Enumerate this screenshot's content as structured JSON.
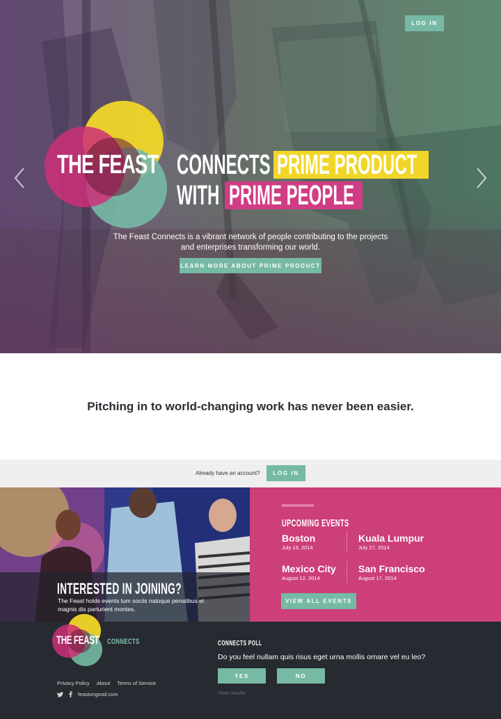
{
  "hero": {
    "login_label": "LOG IN",
    "logo_text": "THE FEAST",
    "headline": {
      "line1_plain": "CONNECTS",
      "line1_highlight": "PRIME PRODUCT",
      "line2_plain": "WITH",
      "line2_highlight": "PRIME PEOPLE"
    },
    "subtitle_line1": "The Feast Connects is a vibrant network of people contributing to the projects",
    "subtitle_line2": "and enterprises transforming our world.",
    "cta_label": "LEARN MORE ABOUT PRIME PRODUCT",
    "prev_icon": "chevron-left-icon",
    "next_icon": "chevron-right-icon"
  },
  "tagline": "Pitching in to world-changing work has never been easier.",
  "account_bar": {
    "text": "Already have an account?",
    "login_label": "LOG IN"
  },
  "join": {
    "title": "INTERESTED IN JOINING?",
    "text": "The Feast holds events tum sociis natoque penatibus et magnis dis parturient montes."
  },
  "events": {
    "title": "UPCOMING EVENTS",
    "items": [
      {
        "city": "Boston",
        "date": "July 15, 2014"
      },
      {
        "city": "Kuala Lumpur",
        "date": "July 27, 2014"
      },
      {
        "city": "Mexico City",
        "date": "August 12, 2014"
      },
      {
        "city": "San Francisco",
        "date": "August 17, 2014"
      }
    ],
    "button_label": "VIEW ALL EVENTS"
  },
  "footer": {
    "logo_text": "THE FEAST",
    "connects_label": "CONNECTS",
    "links": [
      "Privacy Policy",
      "About",
      "Terms of Service"
    ],
    "social_icons": [
      "twitter-icon",
      "facebook-icon"
    ],
    "site": "feastongood.com",
    "poll": {
      "title": "CONNECTS POLL",
      "question": "Do you feel nullam quis risus eget urna mollis ornare vel eu leo?",
      "yes_label": "YES",
      "no_label": "NO",
      "results_label": "View results"
    }
  },
  "colors": {
    "teal": "#76b9a5",
    "yellow": "#f1d628",
    "pink": "#cc3f79",
    "dark": "#272a30"
  }
}
